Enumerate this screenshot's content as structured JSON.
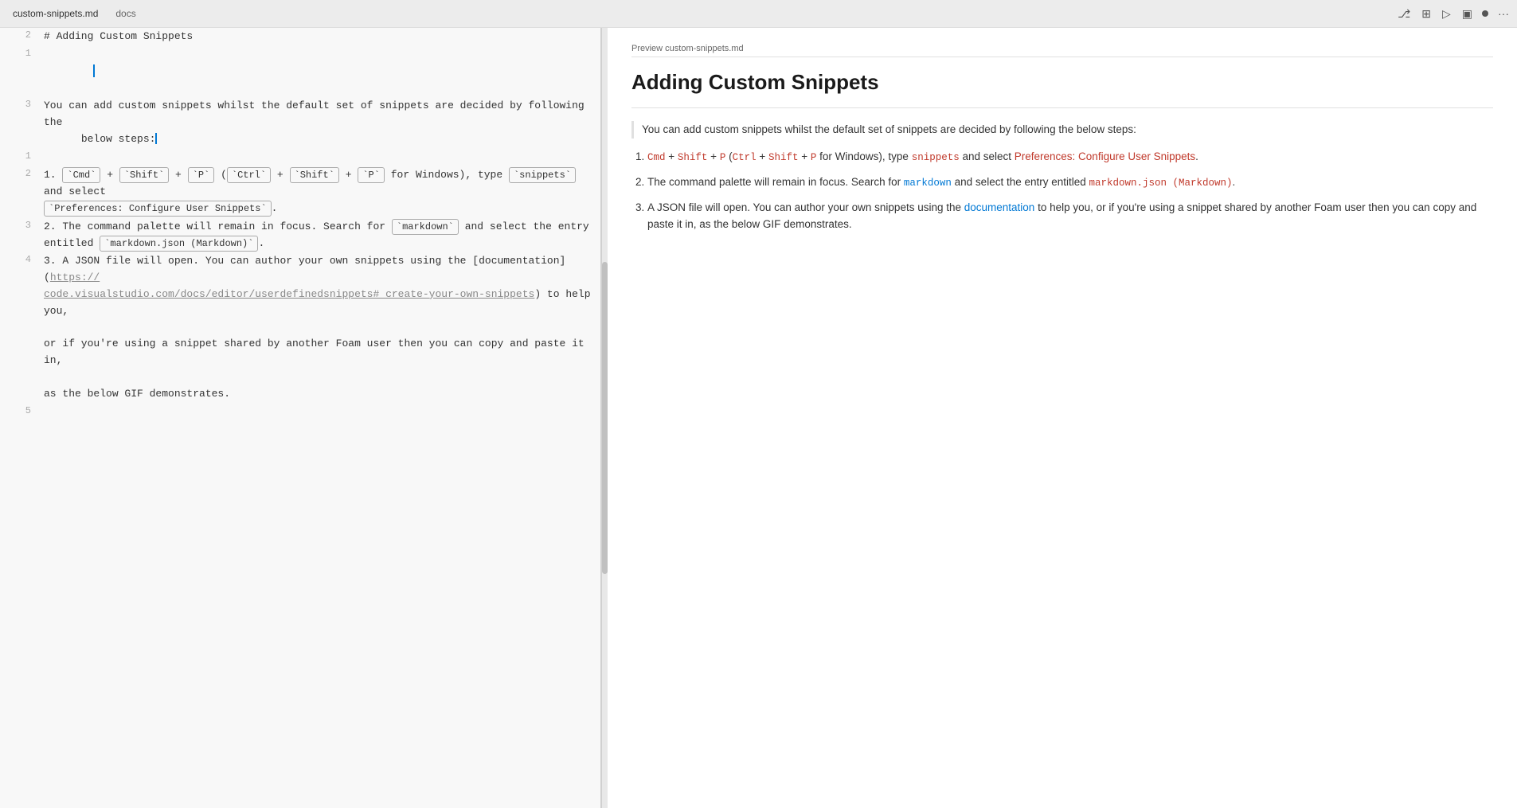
{
  "tabbar": {
    "title": "custom-snippets.md",
    "subtitle": "docs",
    "icons": {
      "branch": "⎇",
      "split": "⊟",
      "run": "▷",
      "layout": "▣",
      "dot": "●",
      "more": "···"
    }
  },
  "preview_tab": {
    "title": "Preview custom-snippets.md"
  },
  "editor": {
    "lines": {
      "line2": "# Adding Custom Snippets",
      "line1_empty": "",
      "line3_part1": "You can add custom snippets whilst the default set of snippets are decided by following the",
      "line3_part2": "below steps:",
      "line1b_empty": "",
      "line2b_list1_pre": "1. ",
      "line2b_list1_post": " for Windows), type ",
      "line2b_list1_select": " and select",
      "line2b_pref": "Preferences: Configure User Snippets",
      "line3b_list2": "2. The command palette will remain in focus. Search for ",
      "line3b_list2_post": " and select the entry",
      "line3b_entitled": "entitled ",
      "line3b_mdfile": "markdown.json (Markdown)",
      "line4_list3": "3. A JSON file will open. You can author your own snippets using the [documentation](https://",
      "line4_url": "code.visualstudio.com/docs/editor/userdefinedsnippets#_create-your-own-snippets",
      "line4_post": ") to help you,",
      "line4_or": "or if you're using a snippet shared by another Foam user then you can copy and paste it in,",
      "line4_as": "as the below GIF demonstrates.",
      "line5_empty": ""
    }
  },
  "preview": {
    "header_label": "Preview custom-snippets.md",
    "title": "Adding Custom Snippets",
    "intro": "You can add custom snippets whilst the default set of snippets are decided by following the below steps:",
    "list": [
      {
        "number": "1.",
        "text_before": " ",
        "cmd_parts": [
          "Cmd",
          "+",
          "Shift",
          "+",
          "P",
          "(",
          "Ctrl",
          "+",
          "Shift",
          "+",
          "P",
          " for Windows), type "
        ],
        "snippets_code": "snippets",
        "text_select": " and select ",
        "preferences": "Preferences: Configure User Snippets",
        "text_end": "."
      },
      {
        "number": "2.",
        "text_before": " The command palette will remain in focus. Search for ",
        "markdown_code": "markdown",
        "text_middle": " and select the entry entitled ",
        "md_json": "markdown.json (Markdown)",
        "text_end": "."
      },
      {
        "number": "3.",
        "text_before": " A JSON file will open. You can author your own snippets using the ",
        "link_text": "documentation",
        "link_href": "https://code.visualstudio.com/docs/editor/userdefinedsnippets#_create-your-own-snippets",
        "text_middle": " to help you, or if you're using a snippet shared by another Foam user then you can copy and paste it in, as the below GIF demonstrates."
      }
    ]
  }
}
